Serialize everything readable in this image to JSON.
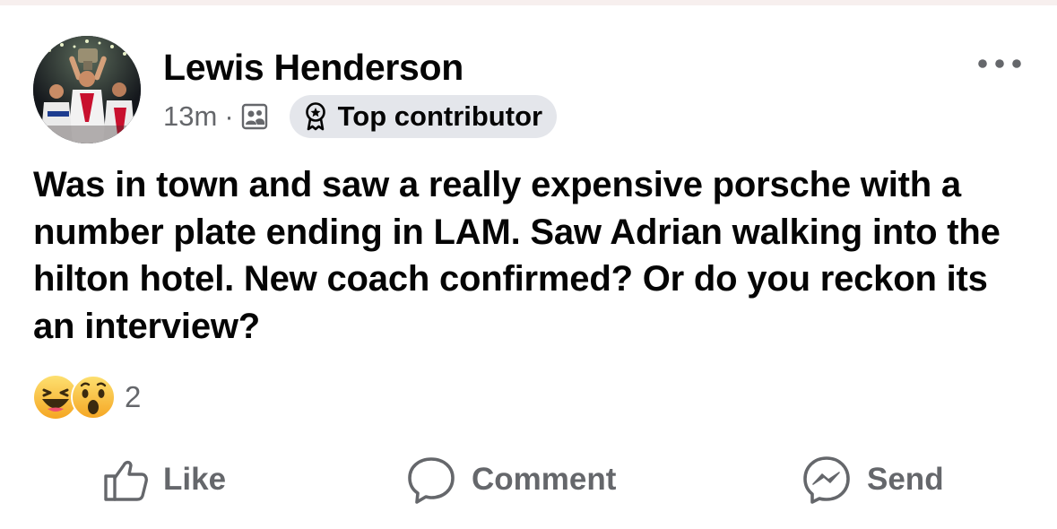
{
  "post": {
    "author": {
      "name": "Lewis Henderson",
      "avatar_icon": "avatar-photo"
    },
    "meta": {
      "time": "13m",
      "separator": "·",
      "audience_icon": "group-members-icon",
      "badge_icon": "ribbon-badge-icon",
      "badge_label": "Top contributor"
    },
    "more_icon": "more-options-icon",
    "body_text": "Was in town and saw a really expensive porsche with a number plate ending in LAM. Saw Adrian walking into the hilton hotel. New coach confirmed? Or do you reckon its an interview?",
    "reactions": {
      "types": [
        "haha",
        "wow"
      ],
      "count": "2"
    },
    "actions": [
      {
        "label": "Like",
        "icon": "thumbs-up-icon"
      },
      {
        "label": "Comment",
        "icon": "comment-bubble-icon"
      },
      {
        "label": "Send",
        "icon": "messenger-icon"
      }
    ]
  },
  "colors": {
    "text_primary": "#050505",
    "text_secondary": "#65676b",
    "badge_background": "#e4e6eb",
    "reaction_yellow": "#f7c33b",
    "background": "#ffffff"
  }
}
